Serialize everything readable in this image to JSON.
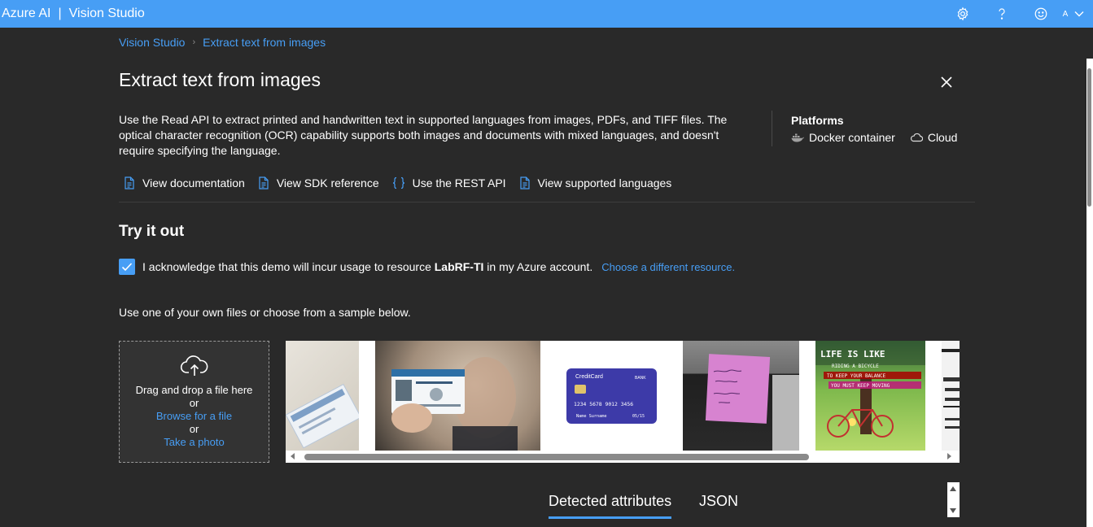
{
  "topbar": {
    "brand": "Azure AI",
    "separator": "|",
    "product": "Vision Studio",
    "icons": [
      "gear-icon",
      "help-icon",
      "smiley-icon"
    ],
    "avatar_initial": "A",
    "bg_color": "#479ef5"
  },
  "breadcrumb": {
    "root": "Vision Studio",
    "current": "Extract text from images"
  },
  "page": {
    "title": "Extract text from images",
    "description": "Use the Read API to extract printed and handwritten text in supported languages from images, PDFs, and TIFF files. The optical character recognition (OCR) capability supports both images and documents with mixed languages, and doesn't require specifying the language."
  },
  "platforms": {
    "title": "Platforms",
    "items": [
      {
        "label": "Docker container",
        "icon": "docker-icon"
      },
      {
        "label": "Cloud",
        "icon": "cloud-icon"
      }
    ]
  },
  "links": [
    {
      "label": "View documentation",
      "icon": "document-icon"
    },
    {
      "label": "View SDK reference",
      "icon": "document-icon"
    },
    {
      "label": "Use the REST API",
      "icon": "braces-icon"
    },
    {
      "label": "View supported languages",
      "icon": "document-icon"
    }
  ],
  "try_it": {
    "title": "Try it out",
    "ack_prefix": "I acknowledge that this demo will incur usage to resource",
    "resource": "LabRF-TI",
    "ack_suffix": "in my Azure account.",
    "change_resource": "Choose a different resource.",
    "checked": true,
    "use_text": "Use one of your own files or choose from a sample below."
  },
  "dropzone": {
    "drag_text": "Drag and drop a file here",
    "or1": "or",
    "browse": "Browse for a file",
    "or2": "or",
    "photo": "Take a photo"
  },
  "samples": [
    {
      "name": "social-security-card"
    },
    {
      "name": "national-identity-card"
    },
    {
      "name": "credit-card",
      "card_brand": "CreditCard",
      "bank": "BANK",
      "number": "1234 5678 9012 3456",
      "holder": "Name Surname",
      "expiry": "05/15"
    },
    {
      "name": "handwritten-sticky-note"
    },
    {
      "name": "life-is-like-bicycle",
      "line1": "LIFE IS LIKE",
      "line2": "RIDING A BICYCLE",
      "line3": "TO KEEP YOUR BALANCE",
      "line4": "YOU MUST KEEP MOVING"
    },
    {
      "name": "nutrition-label"
    }
  ],
  "result_tabs": [
    {
      "label": "Detected attributes",
      "active": true
    },
    {
      "label": "JSON",
      "active": false
    }
  ],
  "colors": {
    "accent": "#479ef5",
    "background": "#292929"
  }
}
